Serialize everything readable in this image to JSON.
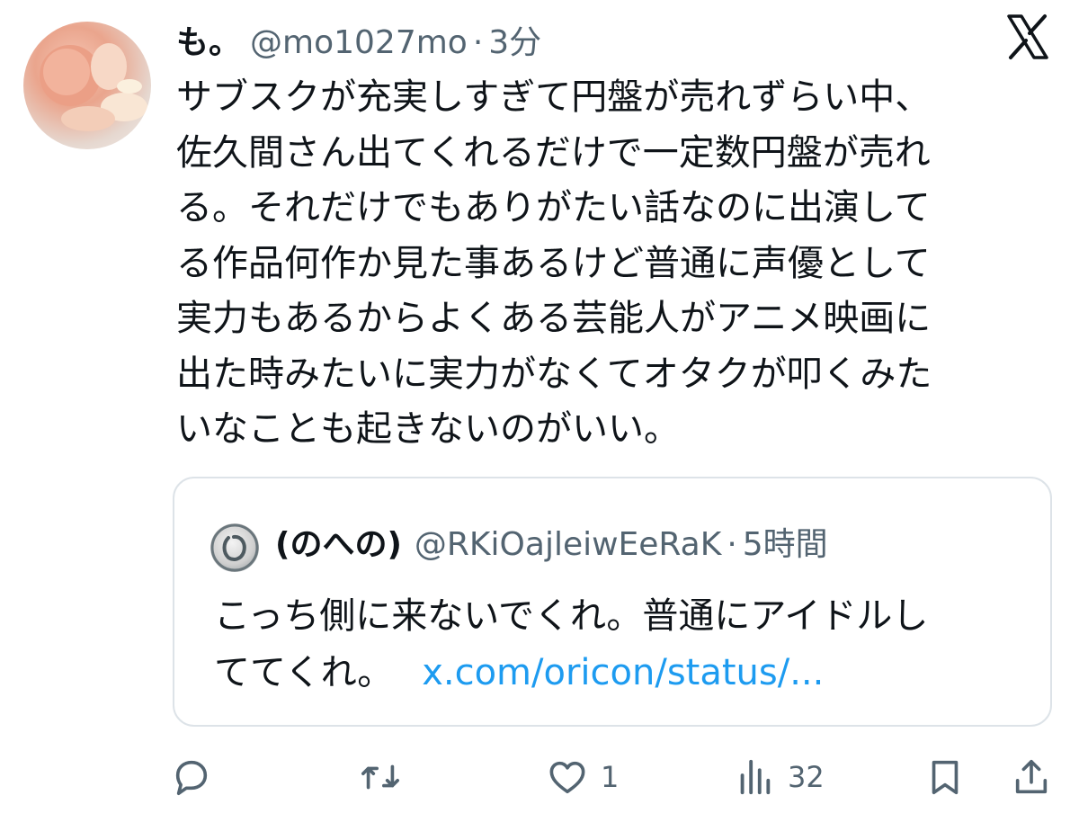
{
  "tweet": {
    "display_name": "も。",
    "handle": "@mo1027mo",
    "separator": "·",
    "time": "3分",
    "text_lines": [
      "サブスクが充実しすぎて円盤が売れずらい中、",
      "佐久間さん出てくれるだけで一定数円盤が売れ",
      "る。それだけでもありがたい話なのに出演して",
      "る作品何作か見た事あるけど普通に声優として",
      "実力もあるからよくある芸能人がアニメ映画に",
      "出た時みたいに実力がなくてオタクが叩くみた",
      "いなことも起きないのがいい。"
    ]
  },
  "quoted": {
    "display_name": "(のへの)",
    "handle": "@RKiOajleiwEeRaK",
    "separator": "·",
    "time": "5時間",
    "text_lines": [
      "こっち側に来ないでくれ。普通にアイドルし",
      "ててくれ。"
    ],
    "link": "x.com/oricon/status/..."
  },
  "actions": {
    "reply_icon": "reply-icon",
    "retweet_icon": "retweet-icon",
    "like_icon": "heart-icon",
    "like_count": "1",
    "views_icon": "views-icon",
    "views_count": "32",
    "bookmark_icon": "bookmark-icon",
    "share_icon": "share-icon"
  },
  "colors": {
    "text": "#0f1419",
    "secondary": "#536471",
    "link": "#1d9bf0",
    "border": "#dde3e8"
  }
}
